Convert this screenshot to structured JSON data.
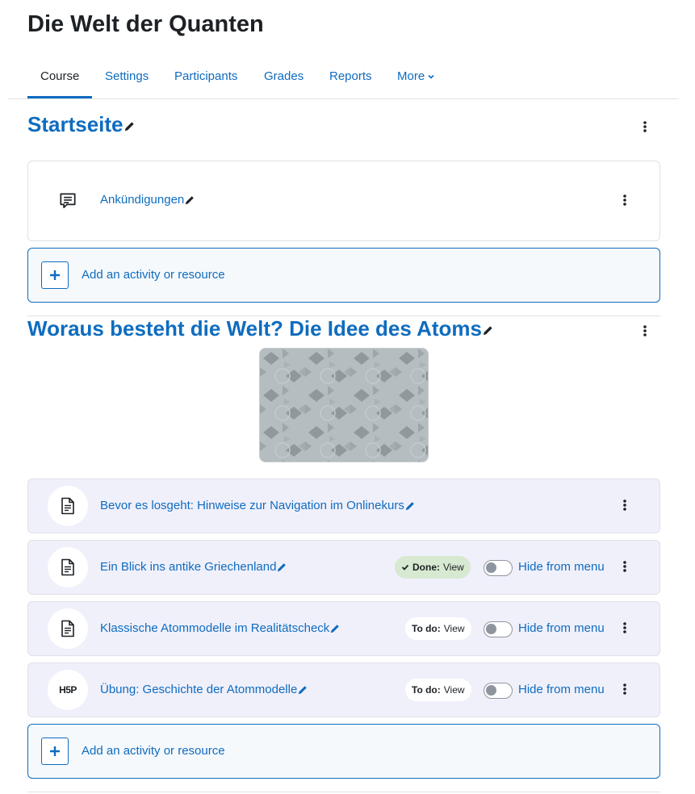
{
  "course": {
    "title": "Die Welt der Quanten"
  },
  "nav": {
    "tabs": [
      {
        "label": "Course",
        "active": true
      },
      {
        "label": "Settings"
      },
      {
        "label": "Participants"
      },
      {
        "label": "Grades"
      },
      {
        "label": "Reports"
      },
      {
        "label": "More"
      }
    ]
  },
  "sections": [
    {
      "title": "Startseite",
      "activities": [
        {
          "name": "Ankündigungen",
          "icon": "forum-icon"
        }
      ],
      "add_label": "Add an activity or resource"
    },
    {
      "title": "Woraus besteht die Welt? Die Idee des Atoms",
      "activities": [
        {
          "name": "Bevor es losgeht: Hinweise zur Navigation im Onlinekurs",
          "icon": "page-icon"
        },
        {
          "name": "Ein Blick ins antike Griechenland",
          "icon": "page-icon",
          "completion": {
            "state": "Done:",
            "action": "View"
          },
          "hide_label": "Hide from menu"
        },
        {
          "name": "Klassische Atommodelle im Realitätscheck",
          "icon": "page-icon",
          "completion": {
            "state": "To do:",
            "action": "View"
          },
          "hide_label": "Hide from menu"
        },
        {
          "name": "Übung: Geschichte der Atommodelle",
          "icon": "h5p-icon",
          "completion": {
            "state": "To do:",
            "action": "View"
          },
          "hide_label": "Hide from menu"
        }
      ],
      "add_label": "Add an activity or resource"
    }
  ],
  "icons": {
    "h5p_text": "H5P"
  },
  "colors": {
    "link": "#0f6cbf",
    "done_badge": "#d7e9d0",
    "activity_bg": "#f0f0fb"
  }
}
